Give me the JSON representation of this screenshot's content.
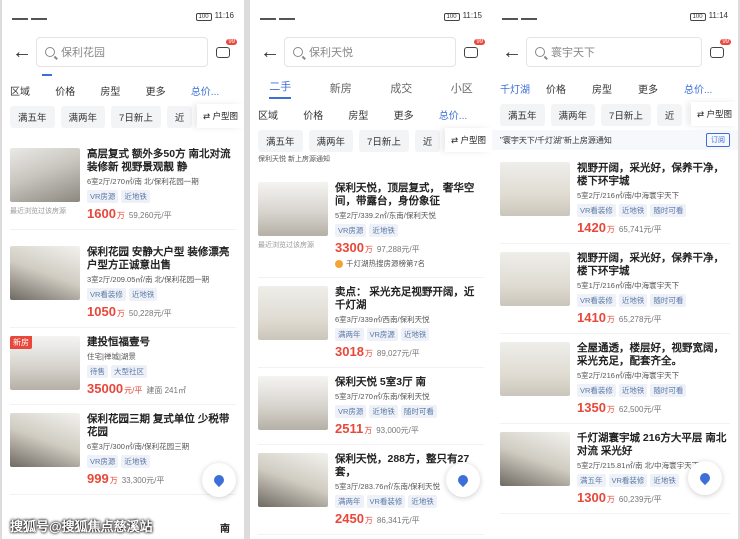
{
  "watermark": "搜狐号@搜狐焦点慈溪站",
  "p1": {
    "time": "11:16",
    "battery": "100",
    "search": "保利花园",
    "badge": "99",
    "filters": [
      "区域",
      "价格",
      "房型",
      "更多",
      "总价..."
    ],
    "tags": [
      "满五年",
      "满两年",
      "7日新上",
      "近"
    ],
    "huxing": "户型图",
    "cards": [
      {
        "title": "高层复式 额外多50方 南北对流 装修新 视野景观靓 静",
        "meta": "6室2厅/270㎡/南 北/保利花园一期",
        "chips": [
          "VR房源",
          "近地铁"
        ],
        "price": "1600",
        "price_unit": "万",
        "unit_price": "59,260元/平",
        "recent": "最近浏览过该房源"
      },
      {
        "title": "保利花园 安静大户型 装修漂亮 户型方正诚意出售",
        "meta": "3室2厅/209.05㎡/南 北/保利花园一期",
        "chips": [
          "VR看装修",
          "近地铁"
        ],
        "price": "1050",
        "price_unit": "万",
        "unit_price": "50,228元/平"
      },
      {
        "title": "建投恒福壹号",
        "meta": "住宅|禅城|湖景",
        "chips": [
          "待售",
          "大型社区"
        ],
        "price": "35000",
        "price_unit": "元/平",
        "unit_price": "建面 241㎡",
        "new": "新房"
      },
      {
        "title": "保利花园三期 复式单位 少税带花园",
        "meta": "6室3厅/300㎡/南/保利花园三期",
        "chips": [
          "VR房源",
          "近地铁"
        ],
        "price": "999",
        "price_unit": "万",
        "unit_price": "33,300元/平"
      }
    ],
    "bottom": "南"
  },
  "p2": {
    "time": "11:15",
    "battery": "100",
    "search": "保利天悦",
    "badge": "99",
    "tabs": [
      "二手",
      "新房",
      "成交",
      "小区"
    ],
    "filters": [
      "区域",
      "价格",
      "房型",
      "更多",
      "总价..."
    ],
    "tags": [
      "满五年",
      "满两年",
      "7日新上",
      "近"
    ],
    "huxing": "户型图",
    "cut": "保利天悦 新上房源通知",
    "cards": [
      {
        "title": "保利天悦，顶层复式， 奢华空间，带露台，身份象征",
        "meta": "5室2厅/339.2㎡/东南/保利天悦",
        "chips": [
          "VR房源",
          "近地铁"
        ],
        "price": "3300",
        "price_unit": "万",
        "unit_price": "97,288元/平",
        "recent": "最近浏览过该房源",
        "hot": "千灯湖热搜房源榜第7名"
      },
      {
        "title": "卖点： 采光充足视野开阔，近千灯湖",
        "meta": "6室3厅/339㎡/西南/保利天悦",
        "chips": [
          "满两年",
          "VR房源",
          "近地铁"
        ],
        "price": "3018",
        "price_unit": "万",
        "unit_price": "89,027元/平"
      },
      {
        "title": "保利天悦 5室3厅 南",
        "meta": "5室3厅/270㎡/东南/保利天悦",
        "chips": [
          "VR房源",
          "近地铁",
          "随时可看"
        ],
        "price": "2511",
        "price_unit": "万",
        "unit_price": "93,000元/平"
      },
      {
        "title": "保利天悦，288方，整只有27套，",
        "meta": "5室3厅/283.76㎡/东南/保利天悦",
        "chips": [
          "满两年",
          "VR看装修",
          "近地铁"
        ],
        "price": "2450",
        "price_unit": "万",
        "unit_price": "86,341元/平"
      }
    ]
  },
  "p3": {
    "time": "11:14",
    "battery": "100",
    "search": "寰宇天下",
    "badge": "99",
    "filters": [
      "千灯湖",
      "价格",
      "房型",
      "更多",
      "总价..."
    ],
    "tags": [
      "满五年",
      "满两年",
      "7日新上",
      "近"
    ],
    "huxing": "户型图",
    "notice": "\"寰宇天下/千灯湖\"新上房源通知",
    "subscribe": "订阅",
    "cards": [
      {
        "title": "视野开阔，采光好，保养干净，楼下环宇城",
        "meta": "5室2厅/216㎡/南/中海寰宇天下",
        "chips": [
          "VR看装修",
          "近地铁",
          "随时可看"
        ],
        "price": "1420",
        "price_unit": "万",
        "unit_price": "65,741元/平"
      },
      {
        "title": "视野开阔，采光好，保养干净，楼下环宇城",
        "meta": "5室1厅/216㎡/南/中海寰宇天下",
        "chips": [
          "VR看装修",
          "近地铁",
          "随时可看"
        ],
        "price": "1410",
        "price_unit": "万",
        "unit_price": "65,278元/平"
      },
      {
        "title": "全屋通透，楼层好，视野宽阔，采光充足，配套齐全。",
        "meta": "5室2厅/216㎡/南/中海寰宇天下",
        "chips": [
          "VR看装修",
          "近地铁",
          "随时可看"
        ],
        "price": "1350",
        "price_unit": "万",
        "unit_price": "62,500元/平"
      },
      {
        "title": "千灯湖寰宇城 216方大平层 南北对流 采光好",
        "meta": "5室2厅/215.81㎡/南 北/中海寰宇天下",
        "chips": [
          "满五年",
          "VR看装修",
          "近地铁"
        ],
        "price": "1300",
        "price_unit": "万",
        "unit_price": "60,239元/平"
      }
    ]
  }
}
